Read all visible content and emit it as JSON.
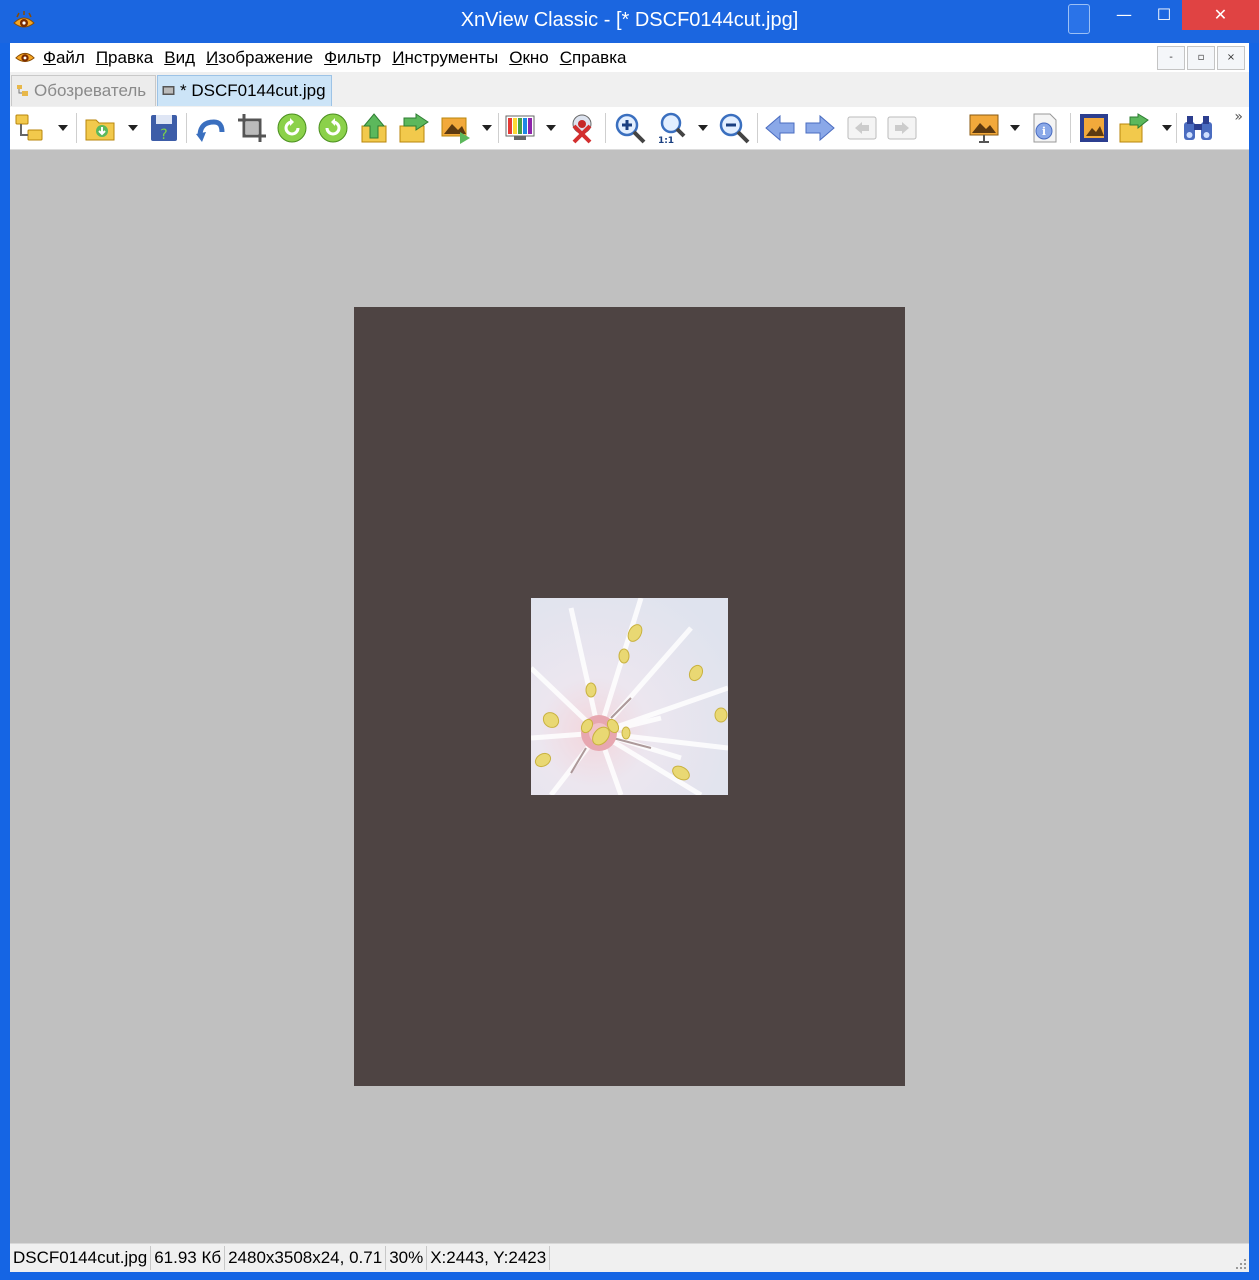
{
  "window": {
    "title": "XnView Classic - [* DSCF0144cut.jpg]",
    "controls": {
      "minimize": "—",
      "maximize": "☐",
      "close": "✕"
    }
  },
  "menu": {
    "items": [
      {
        "label": "Файл",
        "underline": "Ф",
        "rest": "айл"
      },
      {
        "label": "Правка",
        "underline": "П",
        "rest": "равка"
      },
      {
        "label": "Вид",
        "underline": "В",
        "rest": "ид"
      },
      {
        "label": "Изображение",
        "underline": "И",
        "rest": "зображение"
      },
      {
        "label": "Фильтр",
        "underline": "Ф",
        "rest": "ильтр"
      },
      {
        "label": "Инструменты",
        "underline": "И",
        "rest": "нструменты"
      },
      {
        "label": "Окно",
        "underline": "О",
        "rest": "кно"
      },
      {
        "label": "Справка",
        "underline": "С",
        "rest": "правка"
      }
    ],
    "mdi_controls": {
      "minimize": "-",
      "restore": "▫",
      "close": "×"
    }
  },
  "tabs": {
    "browser": "Обозреватель",
    "image": "* DSCF0144cut.jpg"
  },
  "toolbar": {
    "icons": [
      "browser-tree-icon",
      "open-folder-icon",
      "save-icon",
      "undo-icon",
      "crop-icon",
      "rotate-left-icon",
      "rotate-right-icon",
      "upload-icon",
      "forward-icon",
      "convert-icon",
      "adjust-colors-icon",
      "red-eye-icon",
      "zoom-in-icon",
      "zoom-1-1-icon",
      "zoom-out-icon",
      "previous-icon",
      "next-icon",
      "prev-page-icon",
      "next-page-icon",
      "slideshow-icon",
      "info-icon",
      "fullscreen-icon",
      "export-icon",
      "binoculars-icon"
    ],
    "zoom_label": "1:1",
    "more": "»"
  },
  "status": {
    "filename": "DSCF0144cut.jpg",
    "filesize": "61.93 Кб",
    "dimensions": "2480x3508x24, 0.71",
    "zoom": "30%",
    "cursor": "X:2443, Y:2423"
  },
  "colors": {
    "titlebar": "#1b66e0",
    "close_button": "#e04343",
    "viewer_background": "#c0c0c0",
    "canvas": "#4e4443",
    "active_tab": "#cce4f7"
  }
}
